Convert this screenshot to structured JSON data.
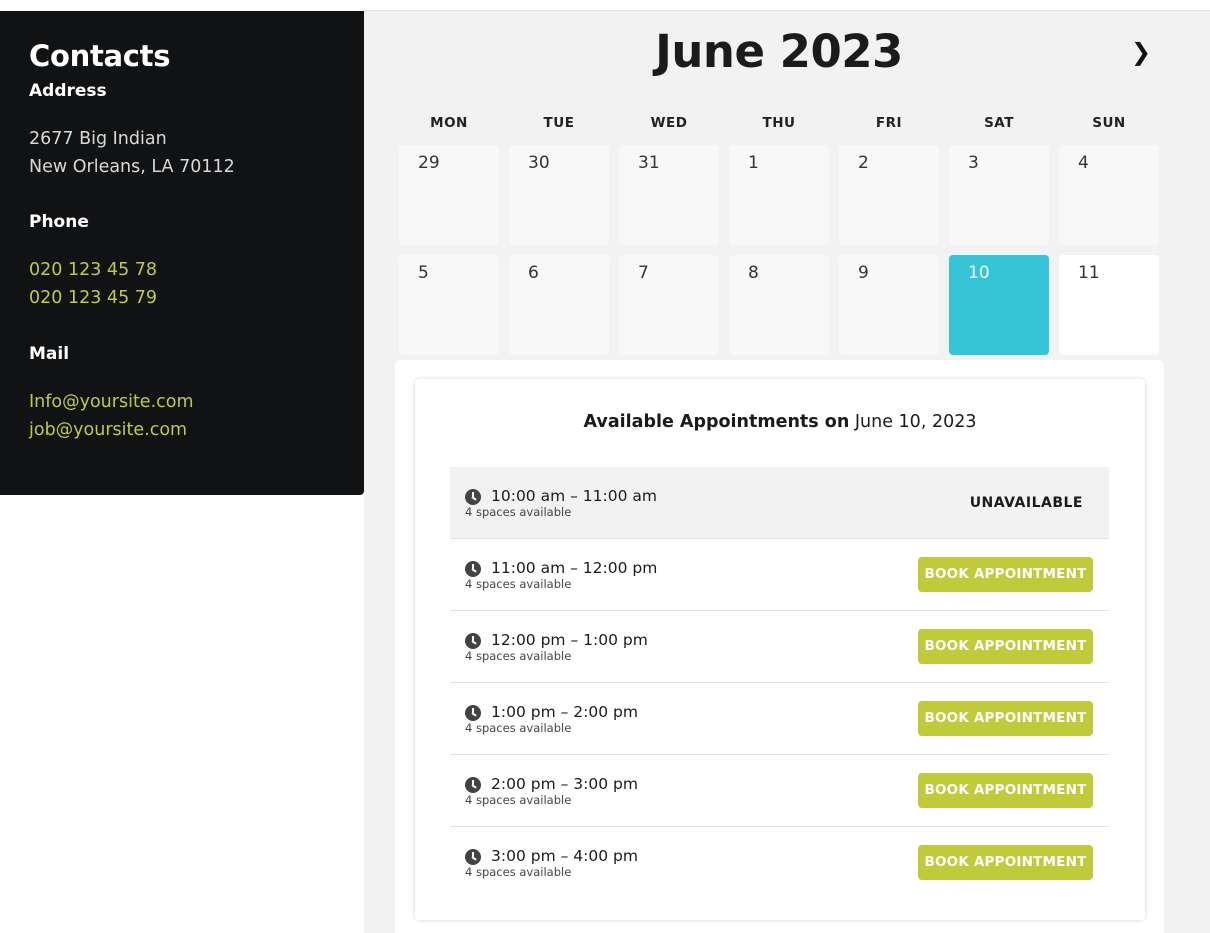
{
  "contacts": {
    "title": "Contacts",
    "address_heading": "Address",
    "address_lines": [
      "2677 Big Indian",
      "New Orleans, LA 70112"
    ],
    "phone_heading": "Phone",
    "phones": [
      "020 123 45 78",
      "020 123 45 79"
    ],
    "mail_heading": "Mail",
    "emails": [
      "Info@yoursite.com",
      "job@yoursite.com"
    ]
  },
  "calendar": {
    "month_title": "June 2023",
    "next_icon": "chevron-right-icon",
    "next_symbol": "❯",
    "weekdays": [
      "MON",
      "TUE",
      "WED",
      "THU",
      "FRI",
      "SAT",
      "SUN"
    ],
    "weeks": [
      [
        "29",
        "30",
        "31",
        "1",
        "2",
        "3",
        "4"
      ],
      [
        "5",
        "6",
        "7",
        "8",
        "9",
        "10",
        "11"
      ]
    ],
    "selected_day": "10",
    "selected_color": "#35c5d6"
  },
  "appointments": {
    "title_bold": "Available Appointments on",
    "title_date": "June 10, 2023",
    "book_label": "BOOK APPOINTMENT",
    "unavailable_label": "UNAVAILABLE",
    "accent_color": "#c0cb3c",
    "slots": [
      {
        "time": "10:00 am – 11:00 am",
        "spaces": "4 spaces available",
        "status": "unavailable"
      },
      {
        "time": "11:00 am – 12:00 pm",
        "spaces": "4 spaces available",
        "status": "available"
      },
      {
        "time": "12:00 pm – 1:00 pm",
        "spaces": "4 spaces available",
        "status": "available"
      },
      {
        "time": "1:00 pm – 2:00 pm",
        "spaces": "4 spaces available",
        "status": "available"
      },
      {
        "time": "2:00 pm – 3:00 pm",
        "spaces": "4 spaces available",
        "status": "available"
      },
      {
        "time": "3:00 pm – 4:00 pm",
        "spaces": "4 spaces available",
        "status": "available"
      }
    ]
  }
}
